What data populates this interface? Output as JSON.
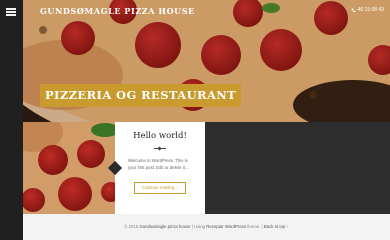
{
  "header": {
    "site_title": "GUNDSØMAGLE PIZZA HOUSE",
    "phone_number": "46 19 08 43",
    "phone_icon": "phone-icon",
    "menu_icon": "hamburger-menu-icon"
  },
  "hero": {
    "banner_text": "PIZZERIA OG RESTAURANT",
    "image": "pepperoni-pizza-photo"
  },
  "post": {
    "title": "Hello world!",
    "excerpt": "Welcome to WordPress. This is your first post. Edit or delete it…",
    "continue_label": "Continue reading…",
    "image": "pizza-photo"
  },
  "footer": {
    "copyright": "© 2016",
    "site_link": "Gundsømagle pizza house",
    "separator1": " | Using ",
    "theme_link": "Receptar WordPress",
    "theme_suffix": " theme. | ",
    "back_to_top": "Back to top",
    "separator2": " ↑"
  },
  "colors": {
    "accent": "#c99a2e",
    "sidebar": "#202020",
    "dark_background": "#2d2d2d",
    "footer_background": "#f3f3f3"
  }
}
